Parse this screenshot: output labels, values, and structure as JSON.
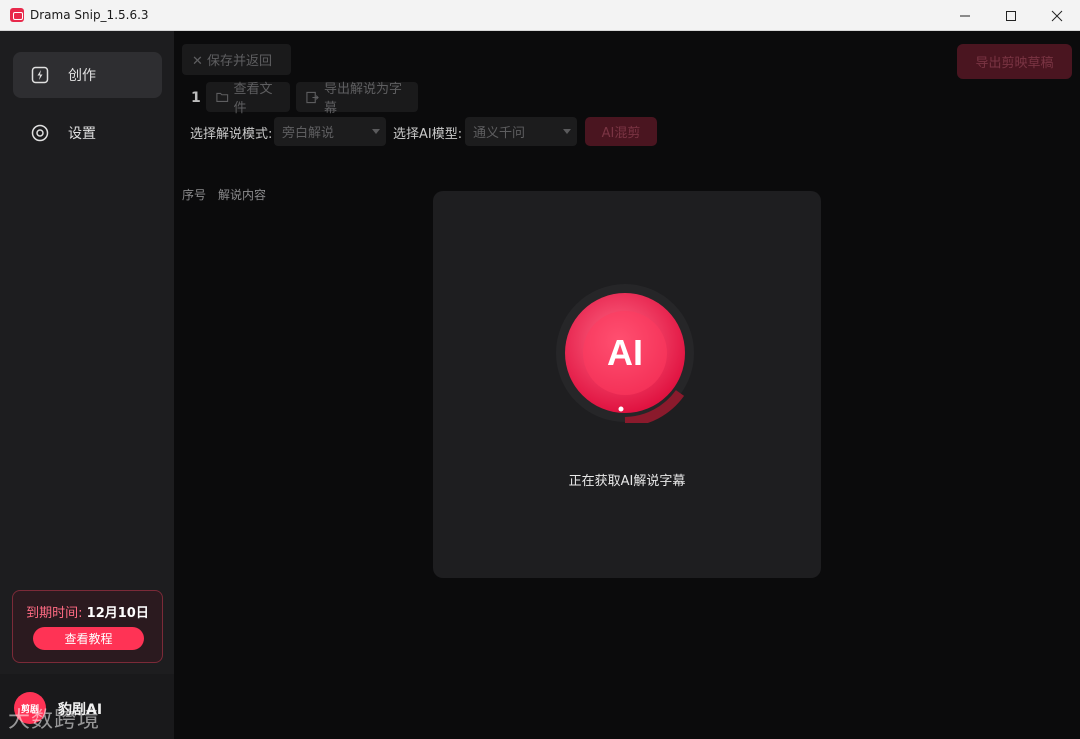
{
  "window": {
    "title": "Drama Snip_1.5.6.3",
    "controls": {
      "minimize": "—",
      "maximize": "☐",
      "close": "✕"
    }
  },
  "sidebar": {
    "items": [
      {
        "label": "创作",
        "icon": "lightning-icon",
        "active": true
      },
      {
        "label": "设置",
        "icon": "settings-icon",
        "active": false
      }
    ],
    "expire": {
      "label": "到期时间:",
      "value": "12月10日"
    },
    "tutorial_button": "查看教程",
    "brand": {
      "avatar_text": "剪剧",
      "name": "豹剧AI"
    },
    "watermark": "大数跨境"
  },
  "toolbar": {
    "save_return": "✕ 保存并返回",
    "export_draft": "导出剪映草稿",
    "index": "1",
    "view_file": "查看文件",
    "export_subtitle": "导出解说为字幕",
    "mode_label": "选择解说模式:",
    "mode_value": "旁白解说",
    "model_label": "选择AI模型:",
    "model_value": "通义千问",
    "ai_cut": "AI混剪"
  },
  "table": {
    "columns": [
      "序号",
      "解说内容"
    ]
  },
  "modal": {
    "logo_text": "AI",
    "status_text": "正在获取AI解说字幕"
  },
  "colors": {
    "accent": "#ff3355",
    "sidebar_bg": "#1d1d1f",
    "main_bg": "#0b0b0c",
    "modal_bg": "#1e1e20"
  }
}
